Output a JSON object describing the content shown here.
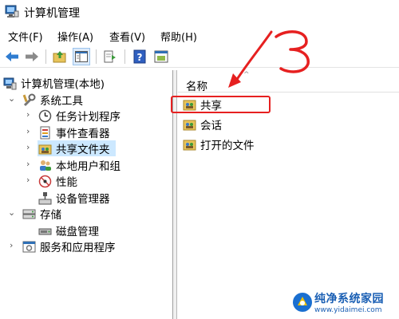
{
  "window": {
    "title": "计算机管理"
  },
  "menubar": {
    "items": [
      "文件(F)",
      "操作(A)",
      "查看(V)",
      "帮助(H)"
    ]
  },
  "toolbar": {
    "buttons": [
      "back-icon",
      "forward-icon",
      "up-folder-icon",
      "show-hide-tree-icon",
      "export-list-icon",
      "help-icon",
      "properties-icon"
    ]
  },
  "tree": {
    "root": {
      "label": "计算机管理(本地)",
      "icon": "computer-management-icon"
    },
    "system_tools": {
      "label": "系统工具",
      "expanded": true,
      "icon": "tools-icon"
    },
    "task_scheduler": {
      "label": "任务计划程序",
      "icon": "clock-icon"
    },
    "event_viewer": {
      "label": "事件查看器",
      "icon": "event-viewer-icon"
    },
    "shared_folders": {
      "label": "共享文件夹",
      "icon": "shared-folder-icon",
      "selected": true
    },
    "local_users": {
      "label": "本地用户和组",
      "icon": "users-icon"
    },
    "performance": {
      "label": "性能",
      "icon": "performance-icon"
    },
    "device_manager": {
      "label": "设备管理器",
      "icon": "device-manager-icon"
    },
    "storage": {
      "label": "存储",
      "expanded": true,
      "icon": "storage-icon"
    },
    "disk_management": {
      "label": "磁盘管理",
      "icon": "disk-icon"
    },
    "services_apps": {
      "label": "服务和应用程序",
      "icon": "services-icon"
    }
  },
  "list": {
    "column_name": "名称",
    "items": [
      {
        "label": "共享",
        "icon": "share-icon"
      },
      {
        "label": "会话",
        "icon": "session-icon"
      },
      {
        "label": "打开的文件",
        "icon": "open-files-icon"
      }
    ]
  },
  "annotation": {
    "step": "3",
    "color": "#e62020"
  },
  "watermark": {
    "line1": "纯净系统家园",
    "line2": "www.yidaimei.com"
  }
}
